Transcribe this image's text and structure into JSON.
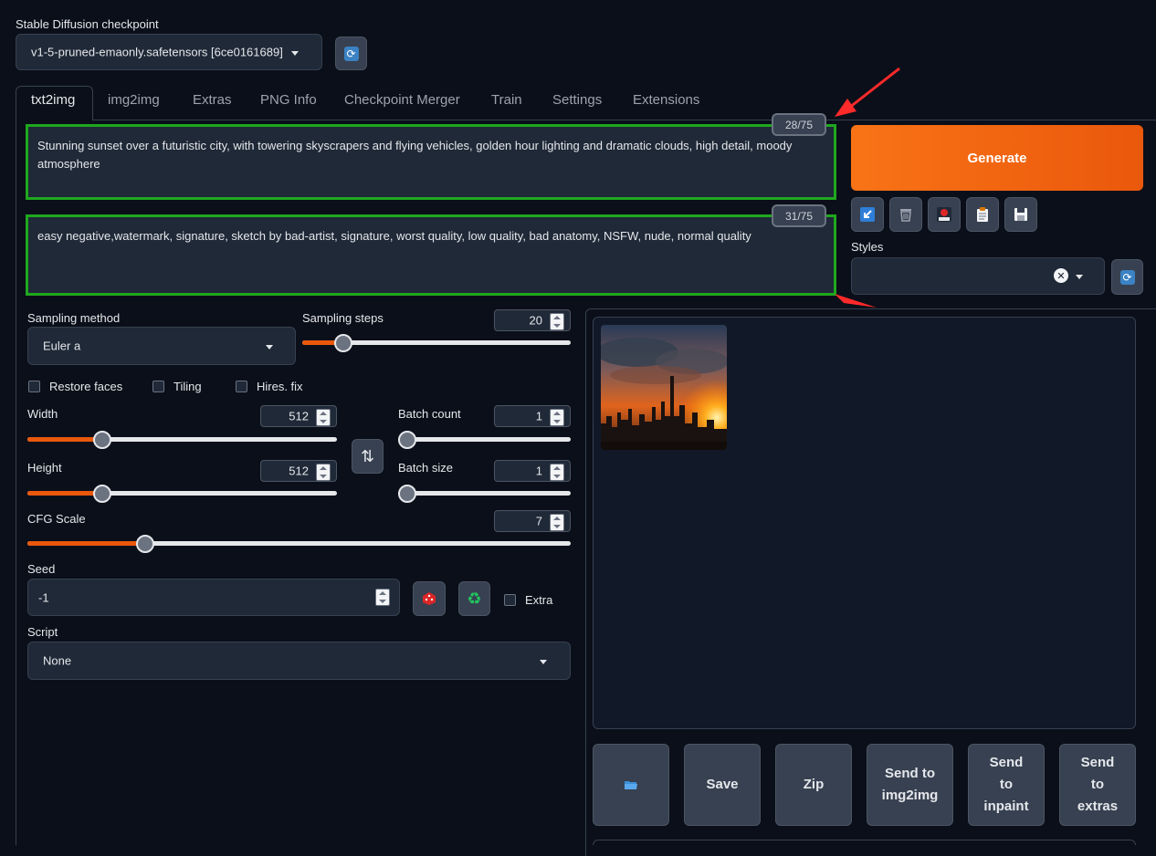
{
  "checkpoint": {
    "label": "Stable Diffusion checkpoint",
    "value": "v1-5-pruned-emaonly.safetensors [6ce0161689]"
  },
  "tabs": [
    {
      "label": "txt2img"
    },
    {
      "label": "img2img"
    },
    {
      "label": "Extras"
    },
    {
      "label": "PNG Info"
    },
    {
      "label": "Checkpoint Merger"
    },
    {
      "label": "Train"
    },
    {
      "label": "Settings"
    },
    {
      "label": "Extensions"
    }
  ],
  "prompt": {
    "text": "Stunning sunset over a futuristic city, with towering skyscrapers and flying vehicles, golden hour lighting and dramatic clouds, high detail, moody atmosphere",
    "counter": "28/75"
  },
  "negative_prompt": {
    "text": "easy negative,watermark, signature, sketch by bad-artist, signature, worst quality, low quality, bad anatomy, NSFW, nude, normal quality",
    "counter": "31/75"
  },
  "generate": {
    "label": "Generate"
  },
  "styles": {
    "label": "Styles",
    "clear_symbol": "✕"
  },
  "sampling_method": {
    "label": "Sampling method",
    "value": "Euler a"
  },
  "sampling_steps": {
    "label": "Sampling steps",
    "value": "20",
    "min": 1,
    "max": 150
  },
  "checkboxes": {
    "restore_faces": "Restore faces",
    "tiling": "Tiling",
    "hires_fix": "Hires. fix"
  },
  "width": {
    "label": "Width",
    "value": "512",
    "min": 64,
    "max": 2048
  },
  "height": {
    "label": "Height",
    "value": "512",
    "min": 64,
    "max": 2048
  },
  "batch_count": {
    "label": "Batch count",
    "value": "1",
    "min": 1,
    "max": 100
  },
  "batch_size": {
    "label": "Batch size",
    "value": "1",
    "min": 1,
    "max": 8
  },
  "cfg_scale": {
    "label": "CFG Scale",
    "value": "7",
    "min": 1,
    "max": 30
  },
  "seed": {
    "label": "Seed",
    "value": "-1",
    "extra_label": "Extra"
  },
  "script": {
    "label": "Script",
    "value": "None"
  },
  "output_actions": {
    "save": "Save",
    "zip": "Zip",
    "send_img2img": "Send to img2img",
    "send_inpaint": "Send to inpaint",
    "send_extras": "Send to extras"
  },
  "colors": {
    "accent": "#ea580c",
    "highlight_border": "#1fa81f",
    "annotation_arrow": "#ff2a2a",
    "background": "#0b0f19"
  }
}
